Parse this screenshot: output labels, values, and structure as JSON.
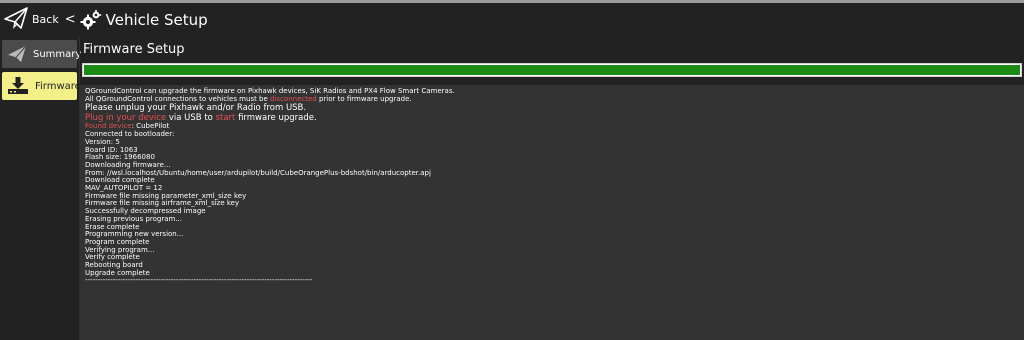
{
  "header": {
    "back_label": "Back",
    "chevron": "<",
    "title": "Vehicle Setup",
    "icons": {
      "back": "paper-plane-icon",
      "title": "gears-icon"
    }
  },
  "sidebar": {
    "items": [
      {
        "label": "Summary",
        "icon": "paper-plane-icon",
        "selected": false
      },
      {
        "label": "Firmware",
        "icon": "download-to-board-icon",
        "selected": true
      }
    ]
  },
  "main": {
    "title": "Firmware Setup",
    "progress": {
      "value_percent": 100,
      "color": "#1a8a12"
    },
    "log": [
      {
        "type": "plain",
        "text": "QGroundControl can upgrade the firmware on Pixhawk devices, SiK Radios and PX4 Flow Smart Cameras."
      },
      {
        "type": "mixed",
        "parts": [
          {
            "text": "All QGroundControl connections to vehicles must be ",
            "color": "white"
          },
          {
            "text": "disconnected",
            "color": "red"
          },
          {
            "text": " prior to firmware upgrade.",
            "color": "white"
          }
        ]
      },
      {
        "type": "big_red",
        "text": "Please unplug your Pixhawk and/or Radio from USB."
      },
      {
        "type": "big_mixed",
        "parts": [
          {
            "text": "Plug in your device",
            "color": "red"
          },
          {
            "text": " via USB to ",
            "color": "white"
          },
          {
            "text": "start",
            "color": "red"
          },
          {
            "text": " firmware upgrade.",
            "color": "white"
          }
        ]
      },
      {
        "type": "mixed",
        "parts": [
          {
            "text": "Found device",
            "color": "red"
          },
          {
            "text": ": CubePilot",
            "color": "white"
          }
        ]
      },
      {
        "type": "plain",
        "text": "Connected to bootloader:"
      },
      {
        "type": "plain",
        "text": "Version: 5"
      },
      {
        "type": "plain",
        "text": "Board ID: 1063"
      },
      {
        "type": "plain",
        "text": "Flash size: 1966080"
      },
      {
        "type": "plain",
        "text": "Downloading firmware..."
      },
      {
        "type": "plain",
        "text": "From: //wsl.localhost/Ubuntu/home/user/ardupilot/build/CubeOrangePlus-bdshot/bin/arducopter.apj"
      },
      {
        "type": "plain",
        "text": "Download complete"
      },
      {
        "type": "plain",
        "text": "MAV_AUTOPILOT = 12"
      },
      {
        "type": "plain",
        "text": "Firmware file missing parameter_xml_size key"
      },
      {
        "type": "plain",
        "text": "Firmware file missing airframe_xml_size key"
      },
      {
        "type": "plain",
        "text": "Successfully decompressed image"
      },
      {
        "type": "plain",
        "text": "Erasing previous program..."
      },
      {
        "type": "plain",
        "text": "Erase complete"
      },
      {
        "type": "plain",
        "text": "Programming new version..."
      },
      {
        "type": "plain",
        "text": "Program complete"
      },
      {
        "type": "plain",
        "text": "Verifying program..."
      },
      {
        "type": "plain",
        "text": "Verify complete"
      },
      {
        "type": "plain",
        "text": "Rebooting board"
      },
      {
        "type": "yellow",
        "text": "Upgrade complete"
      },
      {
        "type": "plain",
        "text": "------------------------------------------------------------------------------------------"
      }
    ]
  },
  "colors": {
    "background": "#222222",
    "log_background": "#333333",
    "selected_item": "#f3f08a",
    "red_text": "#e25050",
    "yellow_text": "#f0e84a"
  }
}
